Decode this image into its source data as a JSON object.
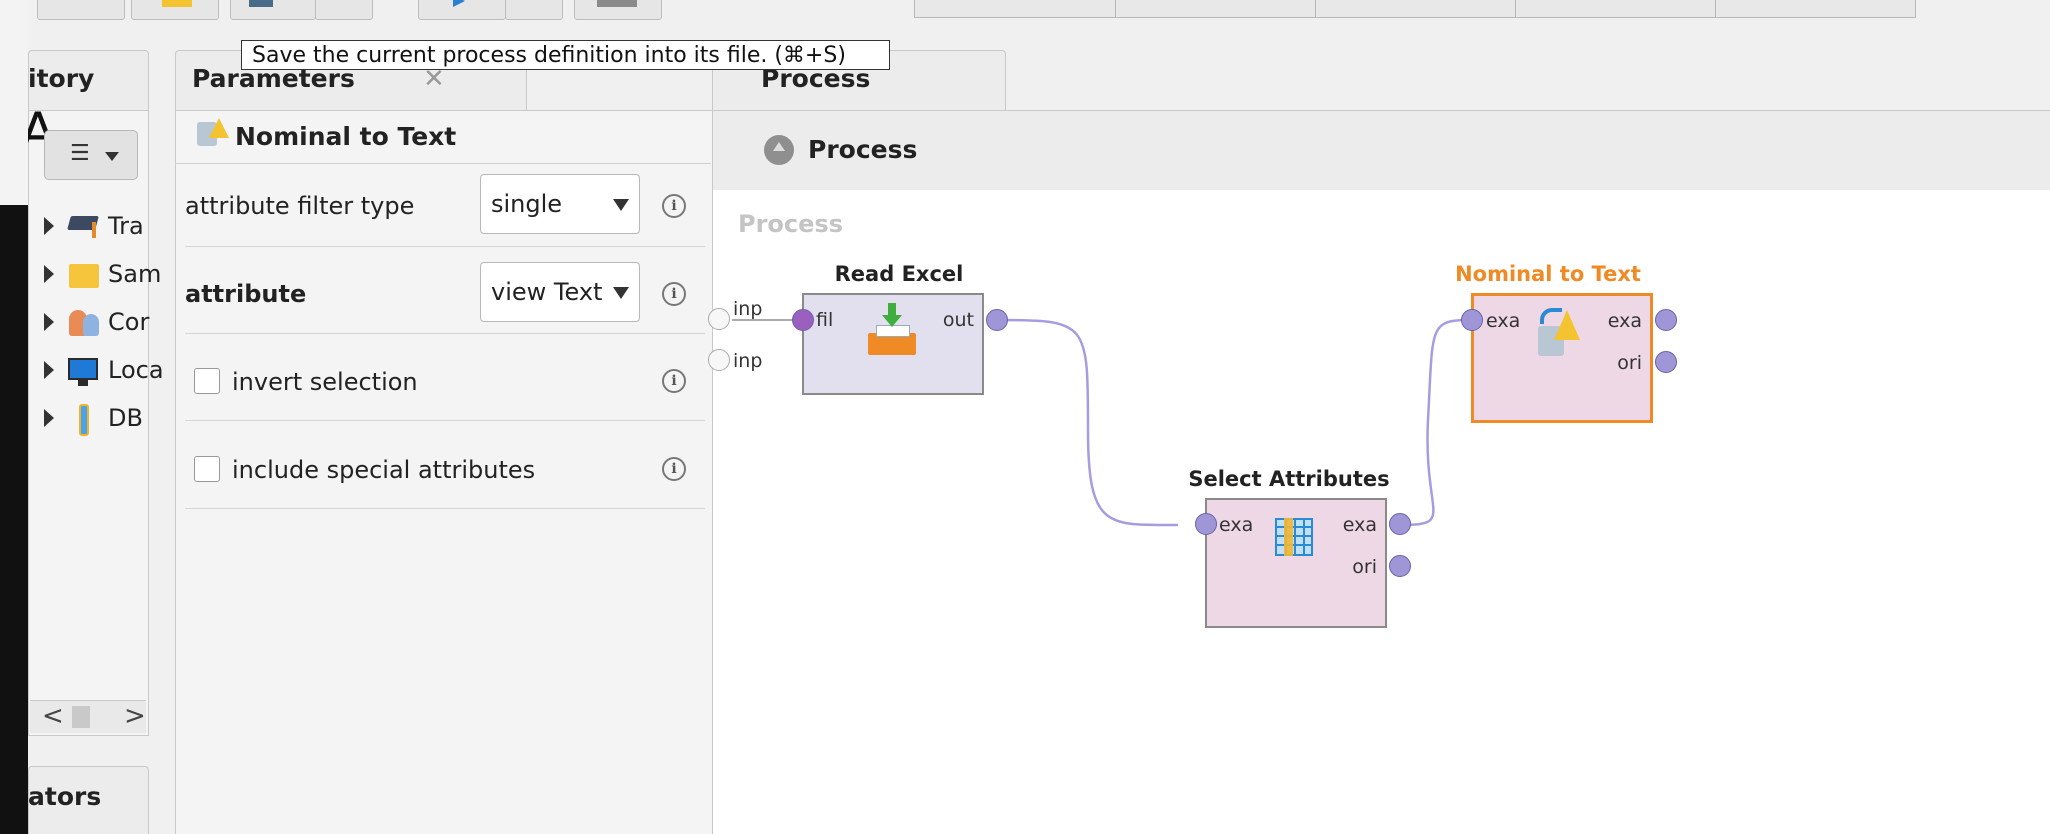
{
  "tooltip": "Save the current process definition into its file. (⌘+S)",
  "repository": {
    "title": "itory",
    "big_letter": "A",
    "items": [
      {
        "label": "Tra",
        "icon": "graduation-cap-icon"
      },
      {
        "label": "Sam",
        "icon": "folder-icon"
      },
      {
        "label": "Cor",
        "icon": "people-icon"
      },
      {
        "label": "Loca",
        "icon": "monitor-icon"
      },
      {
        "label": "DB",
        "icon": "database-icon"
      }
    ],
    "menu_glyph": "☰",
    "scroll_left": "<",
    "scroll_right": ">"
  },
  "operators_panel": {
    "title": "ators"
  },
  "parameters": {
    "title": "Parameters",
    "close_glyph": "✕",
    "operator_name": "Nominal to Text",
    "rows": {
      "filter_type": {
        "label": "attribute filter type",
        "value": "single"
      },
      "attribute": {
        "label": "attribute",
        "value": "view Text"
      },
      "invert": {
        "label": "invert selection",
        "checked": false
      },
      "special": {
        "label": "include special attributes",
        "checked": false
      }
    },
    "info_glyph": "i"
  },
  "process": {
    "tab_title": "Process",
    "breadcrumb": "Process",
    "canvas_label": "Process",
    "input_ports": [
      "inp",
      "inp"
    ],
    "operators": {
      "read_excel": {
        "title": "Read Excel",
        "in_ports": [
          "fil"
        ],
        "out_ports": [
          "out"
        ]
      },
      "select_attributes": {
        "title": "Select Attributes",
        "in_ports": [
          "exa"
        ],
        "out_ports": [
          "exa",
          "ori"
        ]
      },
      "nominal_to_text": {
        "title": "Nominal to Text",
        "in_ports": [
          "exa"
        ],
        "out_ports": [
          "exa",
          "ori"
        ]
      }
    }
  },
  "colors": {
    "selected_operator": "#f08a24",
    "connection": "#a99be0",
    "read_excel_fill": "#e2dfee",
    "operator_fill": "#efd8e6"
  }
}
